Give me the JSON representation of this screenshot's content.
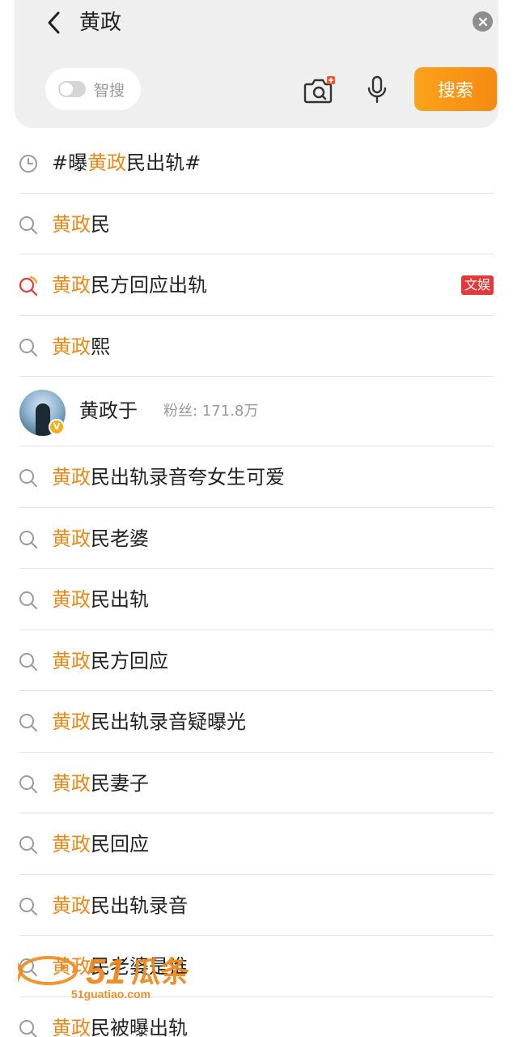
{
  "header": {
    "query": "黄政",
    "smart_search_label": "智搜",
    "search_button_label": "搜索"
  },
  "history": {
    "pre": "#曝",
    "hl": "黄政",
    "post": "民出轨#"
  },
  "suggestions_top": [
    {
      "hl": "黄政",
      "rest": "民"
    },
    {
      "hl": "黄政",
      "rest": "民方回应出轨",
      "tag": "文娱"
    },
    {
      "hl": "黄政",
      "rest": "熙"
    }
  ],
  "user_suggestion": {
    "name": "黄政于",
    "fans": "粉丝: 171.8万"
  },
  "suggestions_bottom": [
    {
      "hl": "黄政",
      "rest": "民出轨录音夸女生可爱"
    },
    {
      "hl": "黄政",
      "rest": "民老婆"
    },
    {
      "hl": "黄政",
      "rest": "民出轨"
    },
    {
      "hl": "黄政",
      "rest": "民方回应"
    },
    {
      "hl": "黄政",
      "rest": "民出轨录音疑曝光"
    },
    {
      "hl": "黄政",
      "rest": "民妻子"
    },
    {
      "hl": "黄政",
      "rest": "民回应"
    },
    {
      "hl": "黄政",
      "rest": "民出轨录音"
    },
    {
      "hl": "黄政",
      "rest": "民老婆是谁"
    },
    {
      "hl": "黄政",
      "rest": "民被曝出轨"
    }
  ],
  "watermark": {
    "number": "51",
    "word": "瓜条",
    "domain": "51guatiao.com"
  },
  "colors": {
    "highlight": "#e8891b",
    "search_button": "#f78a12",
    "tag": "#e23a3a"
  },
  "icons": {
    "back": "chevron-left-icon",
    "clear": "close-circle-icon",
    "camera": "camera-icon",
    "mic": "microphone-icon",
    "history": "clock-icon",
    "search": "search-icon",
    "trending": "trending-search-icon",
    "verified": "verified-badge-icon"
  }
}
